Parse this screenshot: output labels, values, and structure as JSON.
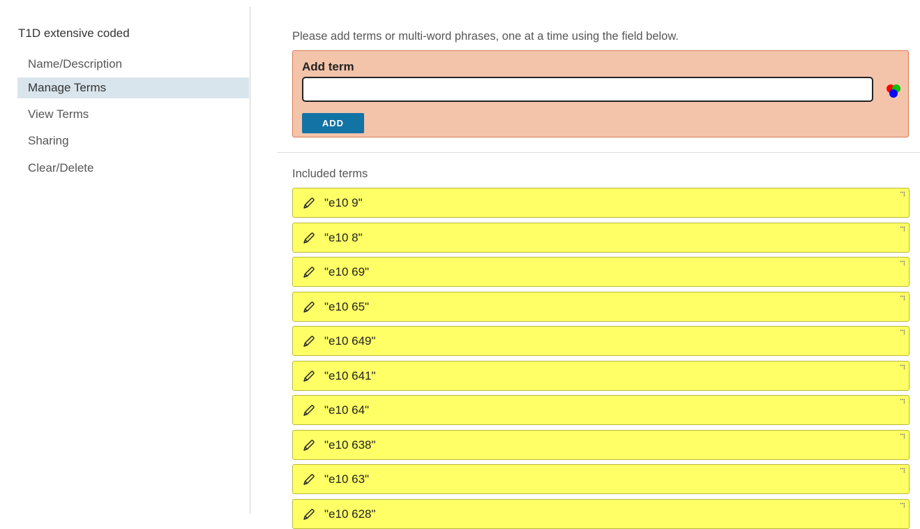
{
  "sidebar": {
    "title": "T1D extensive coded",
    "items": [
      {
        "label": "Name/Description"
      },
      {
        "label": "Manage Terms",
        "active": true
      },
      {
        "label": "View Terms"
      },
      {
        "label": "Sharing"
      },
      {
        "label": "Clear/Delete"
      }
    ]
  },
  "main": {
    "instruction": "Please add terms or multi-word phrases, one at a time using the field below.",
    "add_panel": {
      "label": "Add term",
      "input_value": "",
      "color_icon": "rgb-color-picker-icon",
      "add_button": "ADD",
      "background": "#f3c4aa",
      "border_color": "#d77a55",
      "button_color": "#1273a5"
    },
    "included_label": "Included terms",
    "term_color": "#ffff66",
    "terms": [
      "\"e10 9\"",
      "\"e10 8\"",
      "\"e10 69\"",
      "\"e10 65\"",
      "\"e10 649\"",
      "\"e10 641\"",
      "\"e10 64\"",
      "\"e10 638\"",
      "\"e10 63\"",
      "\"e10 628\""
    ],
    "icons": {
      "edit": "pencil-icon",
      "drag": "drag-handle-icon"
    }
  }
}
